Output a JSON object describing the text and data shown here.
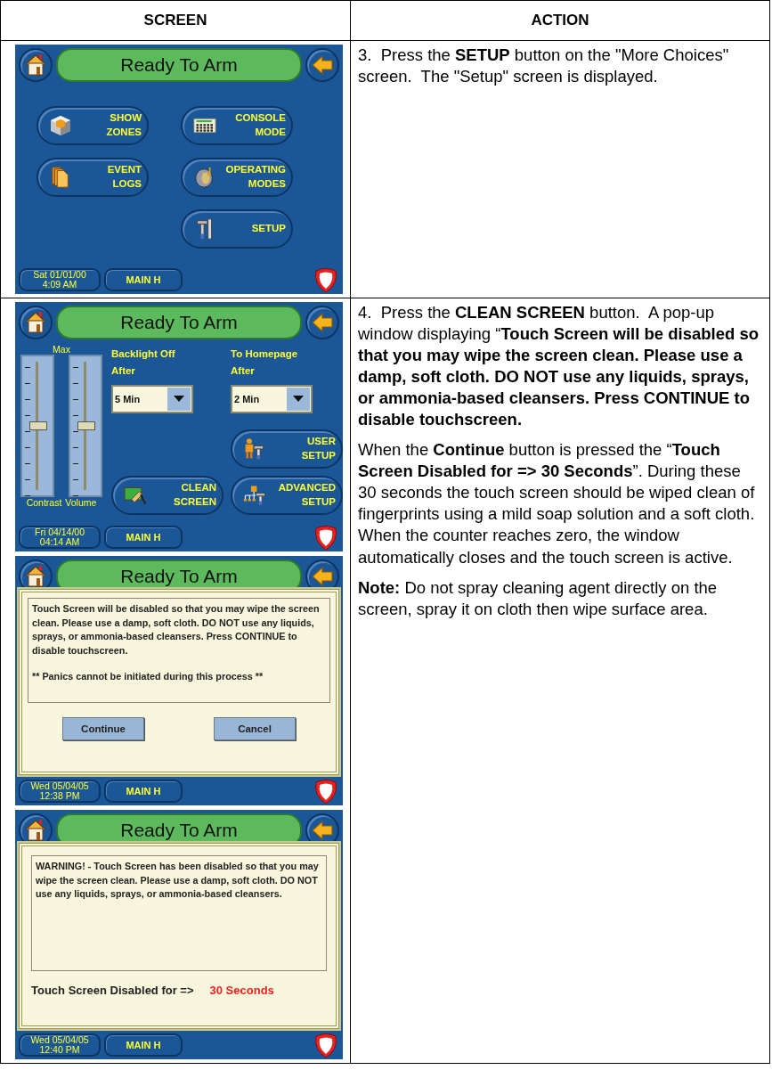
{
  "table": {
    "columns": [
      "SCREEN",
      "ACTION"
    ]
  },
  "rows": [
    {
      "screens": [
        {
          "kind": "menu",
          "title": "Ready To Arm",
          "buttons": [
            {
              "lines": [
                "SHOW",
                "ZONES"
              ]
            },
            {
              "lines": [
                "CONSOLE",
                "MODE"
              ]
            },
            {
              "lines": [
                "EVENT",
                "LOGS"
              ]
            },
            {
              "lines": [
                "OPERATING",
                "MODES"
              ]
            },
            {
              "lines": [
                "SETUP"
              ]
            }
          ],
          "footer": {
            "date": "Sat 01/01/00",
            "time": "4:09 AM",
            "location": "MAIN H"
          }
        }
      ],
      "action": [
        {
          "text": "3.  Press the **SETUP** button on the \"More Choices\" screen.  The \"Setup\" screen is displayed."
        }
      ]
    },
    {
      "screens": [
        {
          "kind": "settings",
          "title": "Ready To Arm",
          "max_label": "Max",
          "sliders": [
            {
              "label": "Contrast",
              "level": 0.5
            },
            {
              "label": "Volume",
              "level": 0.5
            }
          ],
          "dropdowns": [
            {
              "label": "Backlight Off After",
              "value": "5 Min"
            },
            {
              "label": "To Homepage After",
              "value": "2 Min"
            }
          ],
          "buttons": [
            {
              "lines": [
                "USER",
                "SETUP"
              ]
            },
            {
              "lines": [
                "CLEAN",
                "SCREEN"
              ]
            },
            {
              "lines": [
                "ADVANCED",
                "SETUP"
              ]
            }
          ],
          "footer": {
            "date": "Fri 04/14/00",
            "time": "04:14 AM",
            "location": "MAIN H"
          }
        },
        {
          "kind": "dialog",
          "title": "Ready To Arm",
          "message": "Touch Screen will be disabled so that you may wipe the screen clean. Please use a damp, soft cloth. DO NOT use any liquids, sprays, or ammonia-based cleansers. Press CONTINUE to disable touchscreen.",
          "note": "** Panics cannot be initiated during this process **",
          "buttons": [
            "Continue",
            "Cancel"
          ],
          "footer": {
            "date": "Wed 05/04/05",
            "time": "12:38 PM",
            "location": "MAIN H"
          }
        },
        {
          "kind": "warning",
          "title": "Ready To Arm",
          "message": "WARNING! - Touch Screen has been disabled so that you may wipe the screen clean. Please use a damp, soft cloth. DO NOT use any liquids, sprays, or ammonia-based cleansers.",
          "countdown_label": "Touch Screen Disabled for =>",
          "countdown_value": "30 Seconds",
          "footer": {
            "date": "Wed 05/04/05",
            "time": "12:40 PM",
            "location": "MAIN H"
          }
        }
      ],
      "action": [
        {
          "text": "4.  Press the **CLEAN SCREEN** button.  A pop-up window displaying “**Touch Screen will be disabled so that you may wipe the screen clean. Please use a damp, soft cloth. DO NOT use any liquids, sprays, or ammonia-based cleansers. Press CONTINUE to disable touchscreen.**"
        },
        {
          "text": "When the **Continue** button is pressed the “**Touch Screen Disabled for => 30 Seconds**”. During these 30 seconds the touch screen should be wiped clean of fingerprints using a mild soap solution and a soft cloth.  When the counter reaches zero, the window automatically closes and the touch screen is active."
        },
        {
          "text": "**Note:** Do not spray cleaning agent directly on the screen, spray it on cloth then wipe surface area."
        }
      ]
    }
  ]
}
